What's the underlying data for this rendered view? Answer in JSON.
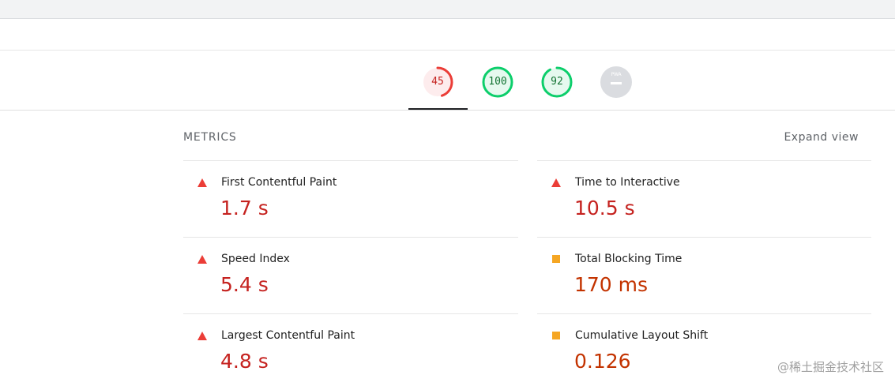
{
  "gauges": [
    {
      "label": "45",
      "value": 0.45,
      "color": "#eb3d37",
      "fill": "#fdeced",
      "text_color": "#c5221f"
    },
    {
      "label": "100",
      "value": 1.0,
      "color": "#0cce6b",
      "fill": "#e6f9ef",
      "text_color": "#137333"
    },
    {
      "label": "92",
      "value": 0.92,
      "color": "#0cce6b",
      "fill": "#e6f9ef",
      "text_color": "#137333"
    },
    {
      "label": "PWA",
      "color": "#dadce0"
    }
  ],
  "metrics": {
    "header": "METRICS",
    "expand_label": "Expand view",
    "left": [
      {
        "title": "First Contentful Paint",
        "value": "1.7 s",
        "status": "fail"
      },
      {
        "title": "Speed Index",
        "value": "5.4 s",
        "status": "fail"
      },
      {
        "title": "Largest Contentful Paint",
        "value": "4.8 s",
        "status": "fail"
      }
    ],
    "right": [
      {
        "title": "Time to Interactive",
        "value": "10.5 s",
        "status": "fail"
      },
      {
        "title": "Total Blocking Time",
        "value": "170 ms",
        "status": "average"
      },
      {
        "title": "Cumulative Layout Shift",
        "value": "0.126",
        "status": "average"
      }
    ]
  },
  "colors": {
    "fail": "#eb3d37",
    "average": "#f5a623"
  },
  "watermark": "@稀土掘金技术社区"
}
